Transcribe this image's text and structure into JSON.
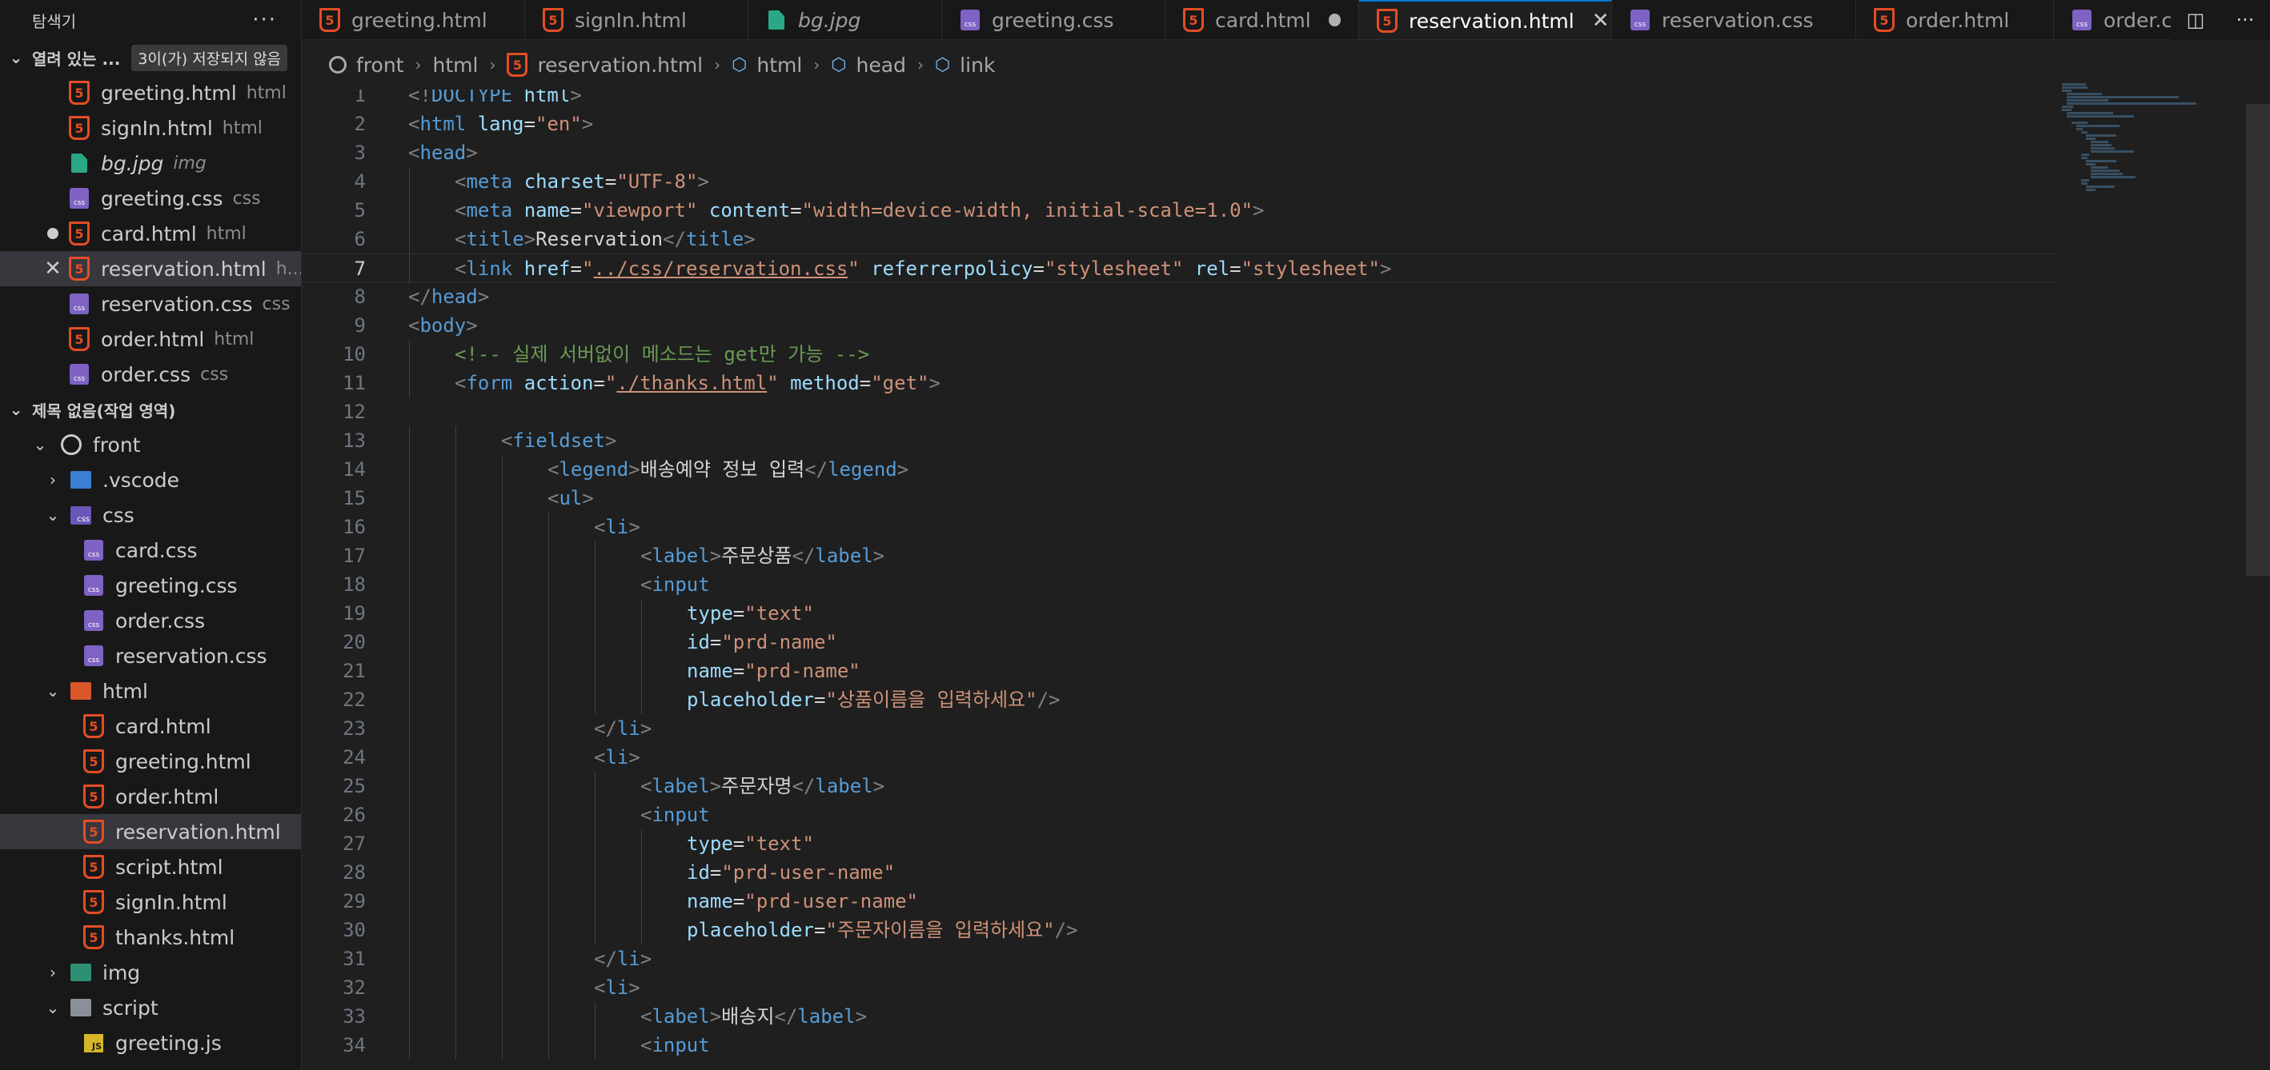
{
  "sidebar": {
    "title": "탐색기",
    "more_label": "···",
    "open_editors": {
      "title": "열려 있는 ...",
      "badge": "3이(가) 저장되지 않음",
      "items": [
        {
          "name": "greeting.html",
          "desc": "html",
          "type": "html"
        },
        {
          "name": "signIn.html",
          "desc": "html",
          "type": "html"
        },
        {
          "name": "bg.jpg",
          "desc": "img",
          "type": "img",
          "italic": true
        },
        {
          "name": "greeting.css",
          "desc": "css",
          "type": "css"
        },
        {
          "name": "card.html",
          "desc": "html",
          "type": "html",
          "dirty": true
        },
        {
          "name": "reservation.html",
          "desc": "h...",
          "type": "html",
          "active": true
        },
        {
          "name": "reservation.css",
          "desc": "css",
          "type": "css"
        },
        {
          "name": "order.html",
          "desc": "html",
          "type": "html"
        },
        {
          "name": "order.css",
          "desc": "css",
          "type": "css"
        }
      ]
    },
    "workspace": {
      "title": "제목 없음(작업 영역)",
      "root": "front",
      "vscode": ".vscode",
      "css_folder": "css",
      "css_files": [
        "card.css",
        "greeting.css",
        "order.css",
        "reservation.css"
      ],
      "html_folder": "html",
      "html_files": [
        "card.html",
        "greeting.html",
        "order.html",
        "reservation.html",
        "script.html",
        "signIn.html",
        "thanks.html"
      ],
      "img_folder": "img",
      "script_folder": "script",
      "script_files": [
        "greeting.js"
      ]
    }
  },
  "tabs": [
    {
      "label": "greeting.html",
      "type": "html"
    },
    {
      "label": "signIn.html",
      "type": "html"
    },
    {
      "label": "bg.jpg",
      "type": "img",
      "italic": true
    },
    {
      "label": "greeting.css",
      "type": "css"
    },
    {
      "label": "card.html",
      "type": "html",
      "dirty": true
    },
    {
      "label": "reservation.html",
      "type": "html",
      "active": true
    },
    {
      "label": "reservation.css",
      "type": "css"
    },
    {
      "label": "order.html",
      "type": "html"
    },
    {
      "label": "order.css",
      "type": "css"
    }
  ],
  "tab_actions": {
    "split": "◫",
    "more": "···"
  },
  "breadcrumb": {
    "root": "front",
    "folder": "html",
    "file": "reservation.html",
    "sym1": "html",
    "sym2": "head",
    "sym3": "link"
  },
  "editor": {
    "current_line": 7,
    "lines": [
      {
        "n": "1",
        "indent": 0,
        "tokens": [
          [
            "t-tag",
            "<!"
          ],
          [
            "t-name",
            "DOCTYPE"
          ],
          [
            "t-text",
            " "
          ],
          [
            "t-attr",
            "html"
          ],
          [
            "t-tag",
            ">"
          ]
        ]
      },
      {
        "n": "2",
        "indent": 0,
        "tokens": [
          [
            "t-tag",
            "<"
          ],
          [
            "t-name",
            "html"
          ],
          [
            "t-text",
            " "
          ],
          [
            "t-attr",
            "lang"
          ],
          [
            "t-text",
            "="
          ],
          [
            "t-str",
            "\"en\""
          ],
          [
            "t-tag",
            ">"
          ]
        ]
      },
      {
        "n": "3",
        "indent": 0,
        "tokens": [
          [
            "t-tag",
            "<"
          ],
          [
            "t-name",
            "head"
          ],
          [
            "t-tag",
            ">"
          ]
        ]
      },
      {
        "n": "4",
        "indent": 1,
        "tokens": [
          [
            "t-tag",
            "<"
          ],
          [
            "t-name",
            "meta"
          ],
          [
            "t-text",
            " "
          ],
          [
            "t-attr",
            "charset"
          ],
          [
            "t-text",
            "="
          ],
          [
            "t-str",
            "\"UTF-8\""
          ],
          [
            "t-tag",
            ">"
          ]
        ]
      },
      {
        "n": "5",
        "indent": 1,
        "tokens": [
          [
            "t-tag",
            "<"
          ],
          [
            "t-name",
            "meta"
          ],
          [
            "t-text",
            " "
          ],
          [
            "t-attr",
            "name"
          ],
          [
            "t-text",
            "="
          ],
          [
            "t-str",
            "\"viewport\""
          ],
          [
            "t-text",
            " "
          ],
          [
            "t-attr",
            "content"
          ],
          [
            "t-text",
            "="
          ],
          [
            "t-str",
            "\"width=device-width, initial-scale=1.0\""
          ],
          [
            "t-tag",
            ">"
          ]
        ]
      },
      {
        "n": "6",
        "indent": 1,
        "tokens": [
          [
            "t-tag",
            "<"
          ],
          [
            "t-name",
            "title"
          ],
          [
            "t-tag",
            ">"
          ],
          [
            "t-text",
            "Reservation"
          ],
          [
            "t-tag",
            "</"
          ],
          [
            "t-name",
            "title"
          ],
          [
            "t-tag",
            ">"
          ]
        ]
      },
      {
        "n": "7",
        "indent": 1,
        "tokens": [
          [
            "t-tag",
            "<"
          ],
          [
            "t-name",
            "link"
          ],
          [
            "t-text",
            " "
          ],
          [
            "t-attr",
            "href"
          ],
          [
            "t-text",
            "="
          ],
          [
            "t-str",
            "\""
          ],
          [
            "t-link",
            "../css/reservation.css"
          ],
          [
            "t-str",
            "\""
          ],
          [
            "t-text",
            " "
          ],
          [
            "t-attr",
            "referrerpolicy"
          ],
          [
            "t-text",
            "="
          ],
          [
            "t-str",
            "\"stylesheet\""
          ],
          [
            "t-text",
            " "
          ],
          [
            "t-attr",
            "rel"
          ],
          [
            "t-text",
            "="
          ],
          [
            "t-str",
            "\"stylesheet\""
          ],
          [
            "t-tag",
            ">"
          ]
        ]
      },
      {
        "n": "8",
        "indent": 0,
        "tokens": [
          [
            "t-tag",
            "</"
          ],
          [
            "t-name",
            "head"
          ],
          [
            "t-tag",
            ">"
          ]
        ]
      },
      {
        "n": "9",
        "indent": 0,
        "tokens": [
          [
            "t-tag",
            "<"
          ],
          [
            "t-name",
            "body"
          ],
          [
            "t-tag",
            ">"
          ]
        ]
      },
      {
        "n": "10",
        "indent": 1,
        "tokens": [
          [
            "t-com",
            "<!-- 실제 서버없이 메소드는 get만 가능 -->"
          ]
        ]
      },
      {
        "n": "11",
        "indent": 1,
        "tokens": [
          [
            "t-tag",
            "<"
          ],
          [
            "t-name",
            "form"
          ],
          [
            "t-text",
            " "
          ],
          [
            "t-attr",
            "action"
          ],
          [
            "t-text",
            "="
          ],
          [
            "t-str",
            "\""
          ],
          [
            "t-link",
            "./thanks.html"
          ],
          [
            "t-str",
            "\""
          ],
          [
            "t-text",
            " "
          ],
          [
            "t-attr",
            "method"
          ],
          [
            "t-text",
            "="
          ],
          [
            "t-str",
            "\"get\""
          ],
          [
            "t-tag",
            ">"
          ]
        ]
      },
      {
        "n": "12",
        "indent": 0,
        "tokens": []
      },
      {
        "n": "13",
        "indent": 2,
        "tokens": [
          [
            "t-tag",
            "<"
          ],
          [
            "t-name",
            "fieldset"
          ],
          [
            "t-tag",
            ">"
          ]
        ]
      },
      {
        "n": "14",
        "indent": 3,
        "tokens": [
          [
            "t-tag",
            "<"
          ],
          [
            "t-name",
            "legend"
          ],
          [
            "t-tag",
            ">"
          ],
          [
            "t-text",
            "배송예약 정보 입력"
          ],
          [
            "t-tag",
            "</"
          ],
          [
            "t-name",
            "legend"
          ],
          [
            "t-tag",
            ">"
          ]
        ]
      },
      {
        "n": "15",
        "indent": 3,
        "tokens": [
          [
            "t-tag",
            "<"
          ],
          [
            "t-name",
            "ul"
          ],
          [
            "t-tag",
            ">"
          ]
        ]
      },
      {
        "n": "16",
        "indent": 4,
        "tokens": [
          [
            "t-tag",
            "<"
          ],
          [
            "t-name",
            "li"
          ],
          [
            "t-tag",
            ">"
          ]
        ]
      },
      {
        "n": "17",
        "indent": 5,
        "tokens": [
          [
            "t-tag",
            "<"
          ],
          [
            "t-name",
            "label"
          ],
          [
            "t-tag",
            ">"
          ],
          [
            "t-text",
            "주문상품"
          ],
          [
            "t-tag",
            "</"
          ],
          [
            "t-name",
            "label"
          ],
          [
            "t-tag",
            ">"
          ]
        ]
      },
      {
        "n": "18",
        "indent": 5,
        "tokens": [
          [
            "t-tag",
            "<"
          ],
          [
            "t-name",
            "input"
          ]
        ]
      },
      {
        "n": "19",
        "indent": 6,
        "tokens": [
          [
            "t-attr",
            "type"
          ],
          [
            "t-text",
            "="
          ],
          [
            "t-str",
            "\"text\""
          ]
        ]
      },
      {
        "n": "20",
        "indent": 6,
        "tokens": [
          [
            "t-attr",
            "id"
          ],
          [
            "t-text",
            "="
          ],
          [
            "t-str",
            "\"prd-name\""
          ]
        ]
      },
      {
        "n": "21",
        "indent": 6,
        "tokens": [
          [
            "t-attr",
            "name"
          ],
          [
            "t-text",
            "="
          ],
          [
            "t-str",
            "\"prd-name\""
          ]
        ]
      },
      {
        "n": "22",
        "indent": 6,
        "tokens": [
          [
            "t-attr",
            "placeholder"
          ],
          [
            "t-text",
            "="
          ],
          [
            "t-str",
            "\"상품이름을 입력하세요\""
          ],
          [
            "t-tag",
            "/>"
          ]
        ]
      },
      {
        "n": "23",
        "indent": 4,
        "tokens": [
          [
            "t-tag",
            "</"
          ],
          [
            "t-name",
            "li"
          ],
          [
            "t-tag",
            ">"
          ]
        ]
      },
      {
        "n": "24",
        "indent": 4,
        "tokens": [
          [
            "t-tag",
            "<"
          ],
          [
            "t-name",
            "li"
          ],
          [
            "t-tag",
            ">"
          ]
        ]
      },
      {
        "n": "25",
        "indent": 5,
        "tokens": [
          [
            "t-tag",
            "<"
          ],
          [
            "t-name",
            "label"
          ],
          [
            "t-tag",
            ">"
          ],
          [
            "t-text",
            "주문자명"
          ],
          [
            "t-tag",
            "</"
          ],
          [
            "t-name",
            "label"
          ],
          [
            "t-tag",
            ">"
          ]
        ]
      },
      {
        "n": "26",
        "indent": 5,
        "tokens": [
          [
            "t-tag",
            "<"
          ],
          [
            "t-name",
            "input"
          ]
        ]
      },
      {
        "n": "27",
        "indent": 6,
        "tokens": [
          [
            "t-attr",
            "type"
          ],
          [
            "t-text",
            "="
          ],
          [
            "t-str",
            "\"text\""
          ]
        ]
      },
      {
        "n": "28",
        "indent": 6,
        "tokens": [
          [
            "t-attr",
            "id"
          ],
          [
            "t-text",
            "="
          ],
          [
            "t-str",
            "\"prd-user-name\""
          ]
        ]
      },
      {
        "n": "29",
        "indent": 6,
        "tokens": [
          [
            "t-attr",
            "name"
          ],
          [
            "t-text",
            "="
          ],
          [
            "t-str",
            "\"prd-user-name\""
          ]
        ]
      },
      {
        "n": "30",
        "indent": 6,
        "tokens": [
          [
            "t-attr",
            "placeholder"
          ],
          [
            "t-text",
            "="
          ],
          [
            "t-str",
            "\"주문자이름을 입력하세요\""
          ],
          [
            "t-tag",
            "/>"
          ]
        ]
      },
      {
        "n": "31",
        "indent": 4,
        "tokens": [
          [
            "t-tag",
            "</"
          ],
          [
            "t-name",
            "li"
          ],
          [
            "t-tag",
            ">"
          ]
        ]
      },
      {
        "n": "32",
        "indent": 4,
        "tokens": [
          [
            "t-tag",
            "<"
          ],
          [
            "t-name",
            "li"
          ],
          [
            "t-tag",
            ">"
          ]
        ]
      },
      {
        "n": "33",
        "indent": 5,
        "tokens": [
          [
            "t-tag",
            "<"
          ],
          [
            "t-name",
            "label"
          ],
          [
            "t-tag",
            ">"
          ],
          [
            "t-text",
            "배송지"
          ],
          [
            "t-tag",
            "</"
          ],
          [
            "t-name",
            "label"
          ],
          [
            "t-tag",
            ">"
          ]
        ]
      },
      {
        "n": "34",
        "indent": 5,
        "tokens": [
          [
            "t-tag",
            "<"
          ],
          [
            "t-name",
            "input"
          ]
        ]
      }
    ]
  }
}
